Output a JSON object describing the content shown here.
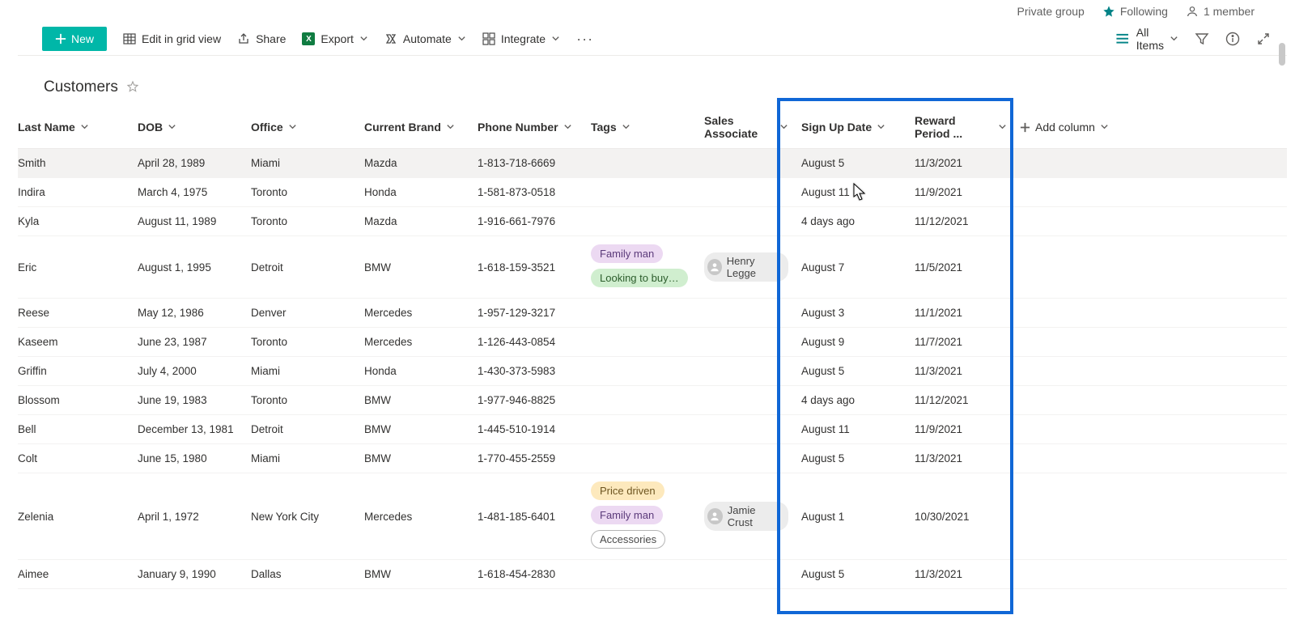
{
  "info_bar": {
    "group_label": "Private group",
    "following_label": "Following",
    "members_label": "1 member"
  },
  "toolbar": {
    "new_label": "New",
    "edit_grid_label": "Edit in grid view",
    "share_label": "Share",
    "export_label": "Export",
    "automate_label": "Automate",
    "integrate_label": "Integrate",
    "all_items_label": "All Items"
  },
  "list": {
    "title": "Customers"
  },
  "columns": {
    "last_name": "Last Name",
    "dob": "DOB",
    "office": "Office",
    "brand": "Current Brand",
    "phone": "Phone Number",
    "tags": "Tags",
    "assoc": "Sales Associate",
    "signup": "Sign Up Date",
    "reward": "Reward Period ...",
    "add": "Add column"
  },
  "tag_styles": {
    "Family man": "tag-family",
    "Looking to buy s...": "tag-buy",
    "Price driven": "tag-price",
    "Accessories": "tag-access"
  },
  "rows": [
    {
      "last": "Smith",
      "dob": "April 28, 1989",
      "office": "Miami",
      "brand": "Mazda",
      "phone": "1-813-718-6669",
      "tags": [],
      "assoc": "",
      "signup": "August 5",
      "reward": "11/3/2021"
    },
    {
      "last": "Indira",
      "dob": "March 4, 1975",
      "office": "Toronto",
      "brand": "Honda",
      "phone": "1-581-873-0518",
      "tags": [],
      "assoc": "",
      "signup": "August 11",
      "reward": "11/9/2021"
    },
    {
      "last": "Kyla",
      "dob": "August 11, 1989",
      "office": "Toronto",
      "brand": "Mazda",
      "phone": "1-916-661-7976",
      "tags": [],
      "assoc": "",
      "signup": "4 days ago",
      "reward": "11/12/2021"
    },
    {
      "last": "Eric",
      "dob": "August 1, 1995",
      "office": "Detroit",
      "brand": "BMW",
      "phone": "1-618-159-3521",
      "tags": [
        "Family man",
        "Looking to buy s..."
      ],
      "assoc": "Henry Legge",
      "signup": "August 7",
      "reward": "11/5/2021"
    },
    {
      "last": "Reese",
      "dob": "May 12, 1986",
      "office": "Denver",
      "brand": "Mercedes",
      "phone": "1-957-129-3217",
      "tags": [],
      "assoc": "",
      "signup": "August 3",
      "reward": "11/1/2021"
    },
    {
      "last": "Kaseem",
      "dob": "June 23, 1987",
      "office": "Toronto",
      "brand": "Mercedes",
      "phone": "1-126-443-0854",
      "tags": [],
      "assoc": "",
      "signup": "August 9",
      "reward": "11/7/2021"
    },
    {
      "last": "Griffin",
      "dob": "July 4, 2000",
      "office": "Miami",
      "brand": "Honda",
      "phone": "1-430-373-5983",
      "tags": [],
      "assoc": "",
      "signup": "August 5",
      "reward": "11/3/2021"
    },
    {
      "last": "Blossom",
      "dob": "June 19, 1983",
      "office": "Toronto",
      "brand": "BMW",
      "phone": "1-977-946-8825",
      "tags": [],
      "assoc": "",
      "signup": "4 days ago",
      "reward": "11/12/2021"
    },
    {
      "last": "Bell",
      "dob": "December 13, 1981",
      "office": "Detroit",
      "brand": "BMW",
      "phone": "1-445-510-1914",
      "tags": [],
      "assoc": "",
      "signup": "August 11",
      "reward": "11/9/2021"
    },
    {
      "last": "Colt",
      "dob": "June 15, 1980",
      "office": "Miami",
      "brand": "BMW",
      "phone": "1-770-455-2559",
      "tags": [],
      "assoc": "",
      "signup": "August 5",
      "reward": "11/3/2021"
    },
    {
      "last": "Zelenia",
      "dob": "April 1, 1972",
      "office": "New York City",
      "brand": "Mercedes",
      "phone": "1-481-185-6401",
      "tags": [
        "Price driven",
        "Family man",
        "Accessories"
      ],
      "assoc": "Jamie Crust",
      "signup": "August 1",
      "reward": "10/30/2021"
    },
    {
      "last": "Aimee",
      "dob": "January 9, 1990",
      "office": "Dallas",
      "brand": "BMW",
      "phone": "1-618-454-2830",
      "tags": [],
      "assoc": "",
      "signup": "August 5",
      "reward": "11/3/2021"
    }
  ]
}
